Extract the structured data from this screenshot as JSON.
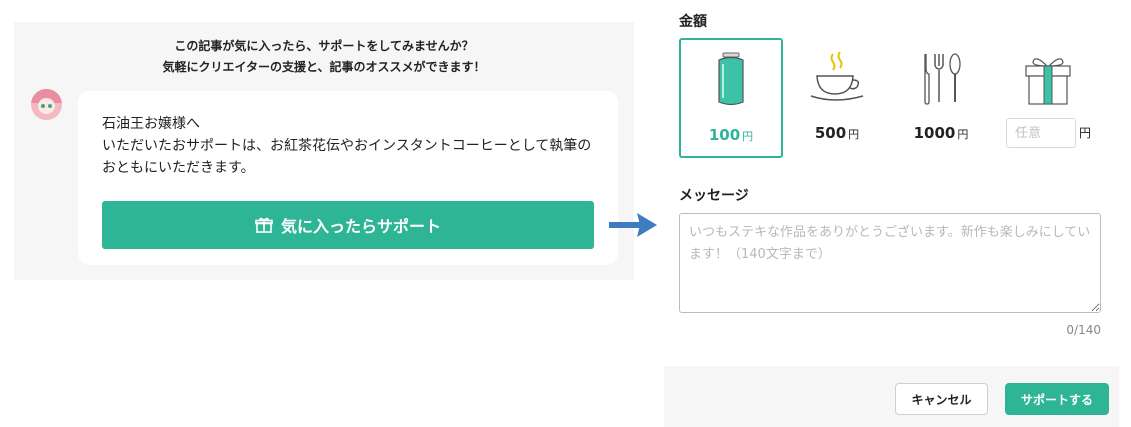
{
  "support_panel": {
    "prompt_line1": "この記事が気に入ったら、サポートをしてみませんか？",
    "prompt_line2": "気軽にクリエイターの支援と、記事のオススメができます！",
    "card": {
      "line1": "石油王お嬢様へ",
      "line2": "いただいたおサポートは、お紅茶花伝やおインスタントコーヒーとして執筆の",
      "line3": "おともにいただきます。"
    },
    "support_button_label": "気に入ったらサポート"
  },
  "amount": {
    "label": "金額",
    "options": [
      {
        "value": "100",
        "unit": "円",
        "icon": "can-icon",
        "selected": true
      },
      {
        "value": "500",
        "unit": "円",
        "icon": "coffee-cup-icon",
        "selected": false
      },
      {
        "value": "1000",
        "unit": "円",
        "icon": "cutlery-icon",
        "selected": false
      }
    ],
    "custom": {
      "placeholder": "任意",
      "unit": "円",
      "icon": "gift-box-icon"
    }
  },
  "message": {
    "label": "メッセージ",
    "placeholder": "いつもステキな作品をありがとうございます。新作も楽しみにしています！（140文字まで）",
    "counter": "0/140"
  },
  "footer": {
    "cancel_label": "キャンセル",
    "submit_label": "サポートする"
  },
  "colors": {
    "accent": "#2db596",
    "arrow": "#3d7cc0",
    "panel_bg": "#f5f6f5"
  }
}
